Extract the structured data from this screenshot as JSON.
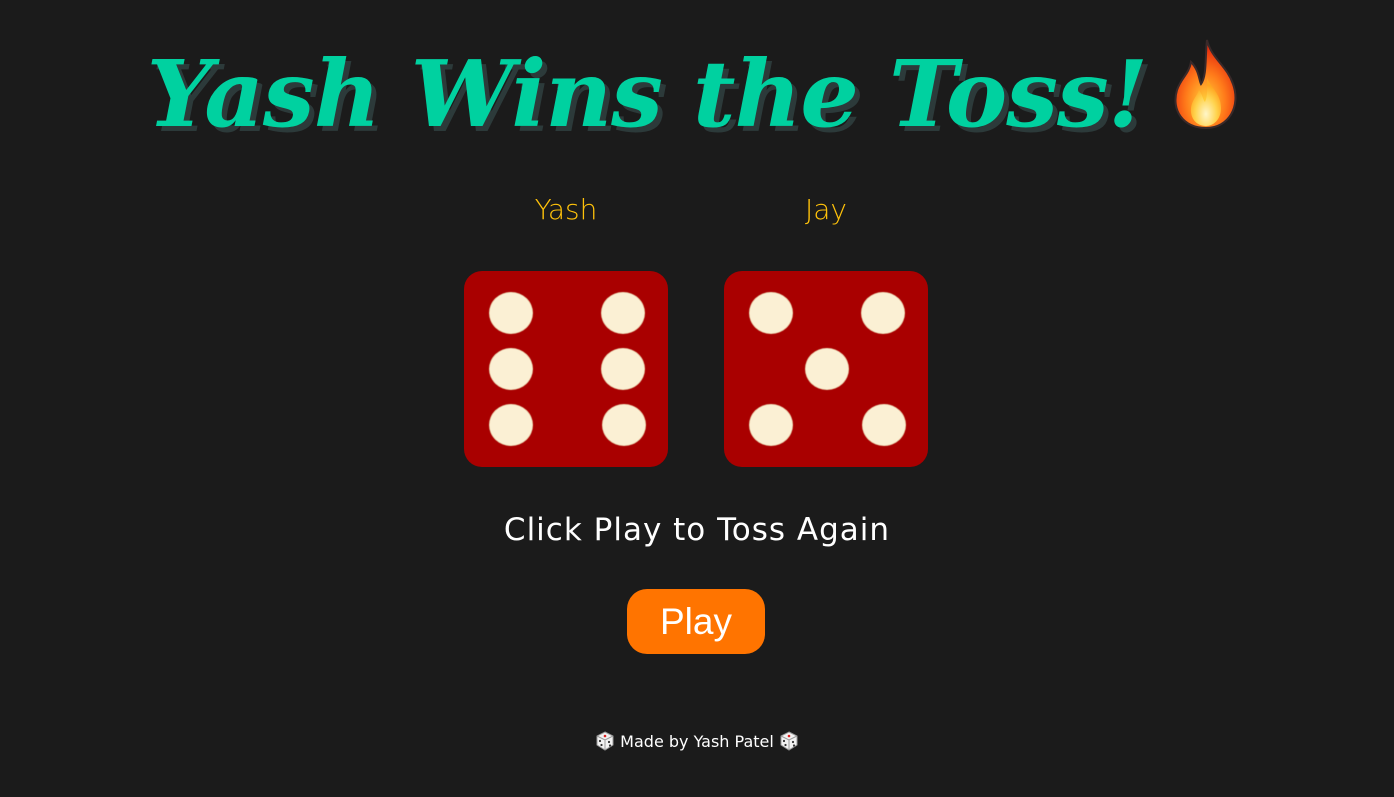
{
  "header": {
    "title": "Yash Wins the Toss!",
    "emoji_icon": "fire-icon"
  },
  "players": [
    {
      "name": "Yash",
      "die_value": 6
    },
    {
      "name": "Jay",
      "die_value": 5
    }
  ],
  "hint": "Click Play to Toss Again",
  "play_button": {
    "label": "Play"
  },
  "footer": {
    "text": "Made by Yash Patel",
    "icon": "dice-icon"
  },
  "colors": {
    "background": "#1b1b1b",
    "title": "#00d1a0",
    "player_name": "#ffc20a",
    "die": "#a90000",
    "pip": "#fbf0d4",
    "button": "#ff7400"
  }
}
